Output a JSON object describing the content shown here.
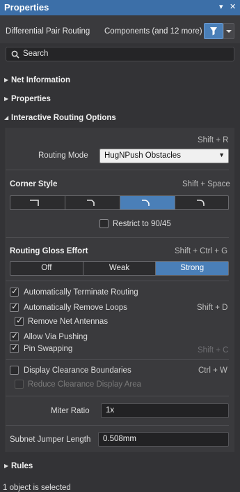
{
  "window": {
    "title": "Properties",
    "pin_glyph": "▾",
    "close_glyph": "✕"
  },
  "context": {
    "object_type": "Differential Pair Routing",
    "filter_summary": "Components (and 12 more)"
  },
  "search": {
    "placeholder": "Search"
  },
  "sections": {
    "net_information": "Net Information",
    "properties": "Properties",
    "interactive_routing_options": "Interactive Routing Options",
    "rules": "Rules"
  },
  "routing": {
    "mode_shortcut": "Shift + R",
    "mode_label": "Routing Mode",
    "mode_value": "HugNPush Obstacles"
  },
  "corner": {
    "title": "Corner Style",
    "shortcut": "Shift + Space",
    "selected_index": 2,
    "restrict_label": "Restrict to 90/45",
    "restrict_checked": false
  },
  "gloss": {
    "title": "Routing Gloss Effort",
    "shortcut": "Shift + Ctrl + G",
    "options": [
      "Off",
      "Weak",
      "Strong"
    ],
    "selected": "Strong"
  },
  "options": {
    "auto_terminate": "Automatically Terminate Routing",
    "auto_remove_loops": "Automatically Remove Loops",
    "auto_remove_loops_shortcut": "Shift + D",
    "remove_antennas": "Remove Net Antennas",
    "allow_via_pushing": "Allow Via Pushing",
    "pin_swapping": "Pin Swapping",
    "pin_swapping_shortcut": "Shift + C",
    "display_clearance": "Display Clearance Boundaries",
    "display_clearance_shortcut": "Ctrl + W",
    "reduce_clearance": "Reduce Clearance Display Area"
  },
  "miter": {
    "label": "Miter Ratio",
    "value": "1x"
  },
  "subnet": {
    "label": "Subnet Jumper Length",
    "value": "0.508mm"
  },
  "status": {
    "text": "1 object is selected"
  },
  "colors": {
    "accent": "#4a7fb8",
    "title_bar": "#3c6fa8",
    "background": "#333336"
  }
}
